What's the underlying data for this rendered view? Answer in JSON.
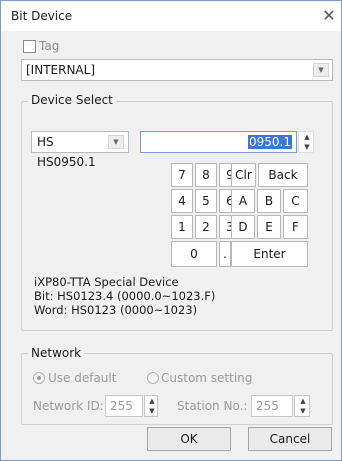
{
  "title": "Bit Device",
  "tag": {
    "label": "Tag",
    "checked": false
  },
  "source": {
    "value": "[INTERNAL]"
  },
  "device_select": {
    "legend": "Device Select",
    "device_type": "HS",
    "address_value": "0950.1",
    "preview": "HS0950.1",
    "keypad": {
      "row1": [
        "7",
        "8",
        "9",
        "Clr",
        "Back"
      ],
      "row2": [
        "4",
        "5",
        "6",
        "A",
        "B",
        "C"
      ],
      "row3": [
        "1",
        "2",
        "3",
        "D",
        "E",
        "F"
      ],
      "row4": [
        "0",
        ".",
        "Enter"
      ]
    },
    "info": {
      "line1": "iXP80-TTA Special Device",
      "line2": "Bit: HS0123.4 (0000.0~1023.F)",
      "line3": "Word: HS0123 (0000~1023)"
    }
  },
  "network": {
    "legend": "Network",
    "use_default": "Use default",
    "custom_setting": "Custom setting",
    "selected": "Use default",
    "network_id_label": "Network ID:",
    "network_id_value": "255",
    "station_no_label": "Station No.:",
    "station_no_value": "255"
  },
  "buttons": {
    "ok": "OK",
    "cancel": "Cancel"
  },
  "icons": {
    "close": "close-icon",
    "dropdown": "chevron-down-icon",
    "spin_up": "spin-up-icon",
    "spin_down": "spin-down-icon"
  }
}
